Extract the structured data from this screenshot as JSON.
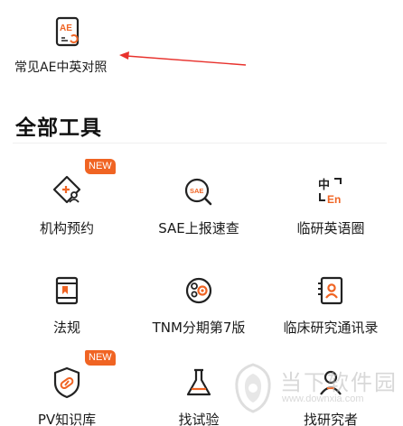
{
  "recent": {
    "label": "常见AE中英对照",
    "icon": "ae-document-icon"
  },
  "section": {
    "title": "全部工具"
  },
  "tools": [
    {
      "label": "机构预约",
      "icon": "institution-appointment-icon",
      "badge": "NEW"
    },
    {
      "label": "SAE上报速查",
      "icon": "sae-search-icon",
      "badge": ""
    },
    {
      "label": "临研英语圈",
      "icon": "chinese-english-icon",
      "badge": ""
    },
    {
      "label": "法规",
      "icon": "regulation-book-icon",
      "badge": ""
    },
    {
      "label": "TNM分期第7版",
      "icon": "tnm-staging-icon",
      "badge": ""
    },
    {
      "label": "临床研究通讯录",
      "icon": "contacts-icon",
      "badge": ""
    },
    {
      "label": "PV知识库",
      "icon": "pv-shield-icon",
      "badge": "NEW"
    },
    {
      "label": "找试验",
      "icon": "flask-icon",
      "badge": ""
    },
    {
      "label": "找研究者",
      "icon": "researcher-icon",
      "badge": ""
    }
  ],
  "watermark": {
    "title": "当下软件园",
    "url": "www.downxia.com"
  },
  "colors": {
    "accent": "#f06423",
    "icon_stroke": "#222222",
    "annotation": "#e8322d"
  }
}
